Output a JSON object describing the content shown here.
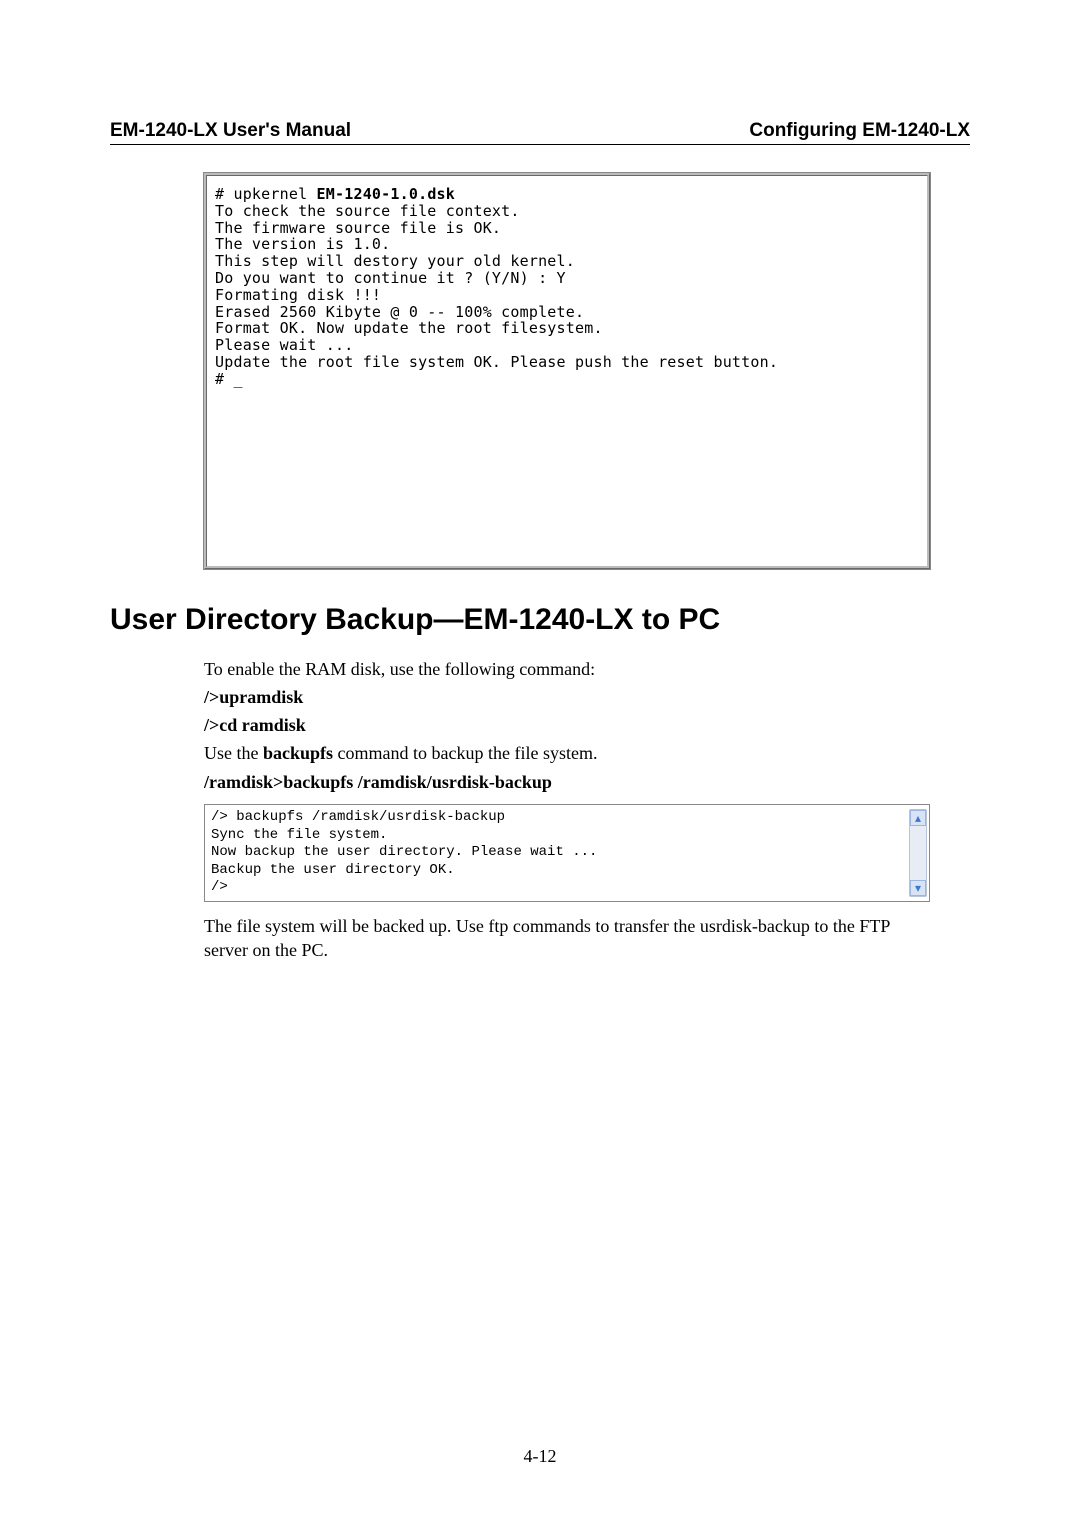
{
  "header": {
    "left": "EM-1240-LX User's Manual",
    "right": "Configuring EM-1240-LX"
  },
  "terminal1": {
    "prefix": "# upkernel ",
    "boldpart": "EM-1240-1.0.dsk",
    "rest": "\nTo check the source file context.\nThe firmware source file is OK.\nThe version is 1.0.\nThis step will destory your old kernel.\nDo you want to continue it ? (Y/N) : Y\nFormating disk !!!\nErased 2560 Kibyte @ 0 -- 100% complete.\nFormat OK. Now update the root filesystem.\nPlease wait ...\nUpdate the root file system OK. Please push the reset button.\n# _"
  },
  "section_title": "User Directory Backup—EM-1240-LX to PC",
  "body": {
    "p1": "To enable the RAM disk, use the following command:",
    "cmd1": "/>upramdisk",
    "cmd2": "/>cd ramdisk",
    "p2_a": "Use the ",
    "p2_bold": "backupfs",
    "p2_b": " command to backup the file system.",
    "cmd3": "/ramdisk>backupfs /ramdisk/usrdisk-backup",
    "p3": "The file system will be backed up. Use ftp commands to transfer the usrdisk-backup to the FTP server on the PC."
  },
  "terminal2": "/> backupfs /ramdisk/usrdisk-backup\nSync the file system.\nNow backup the user directory. Please wait ...\nBackup the user directory OK.\n/>",
  "page_number": "4-12"
}
